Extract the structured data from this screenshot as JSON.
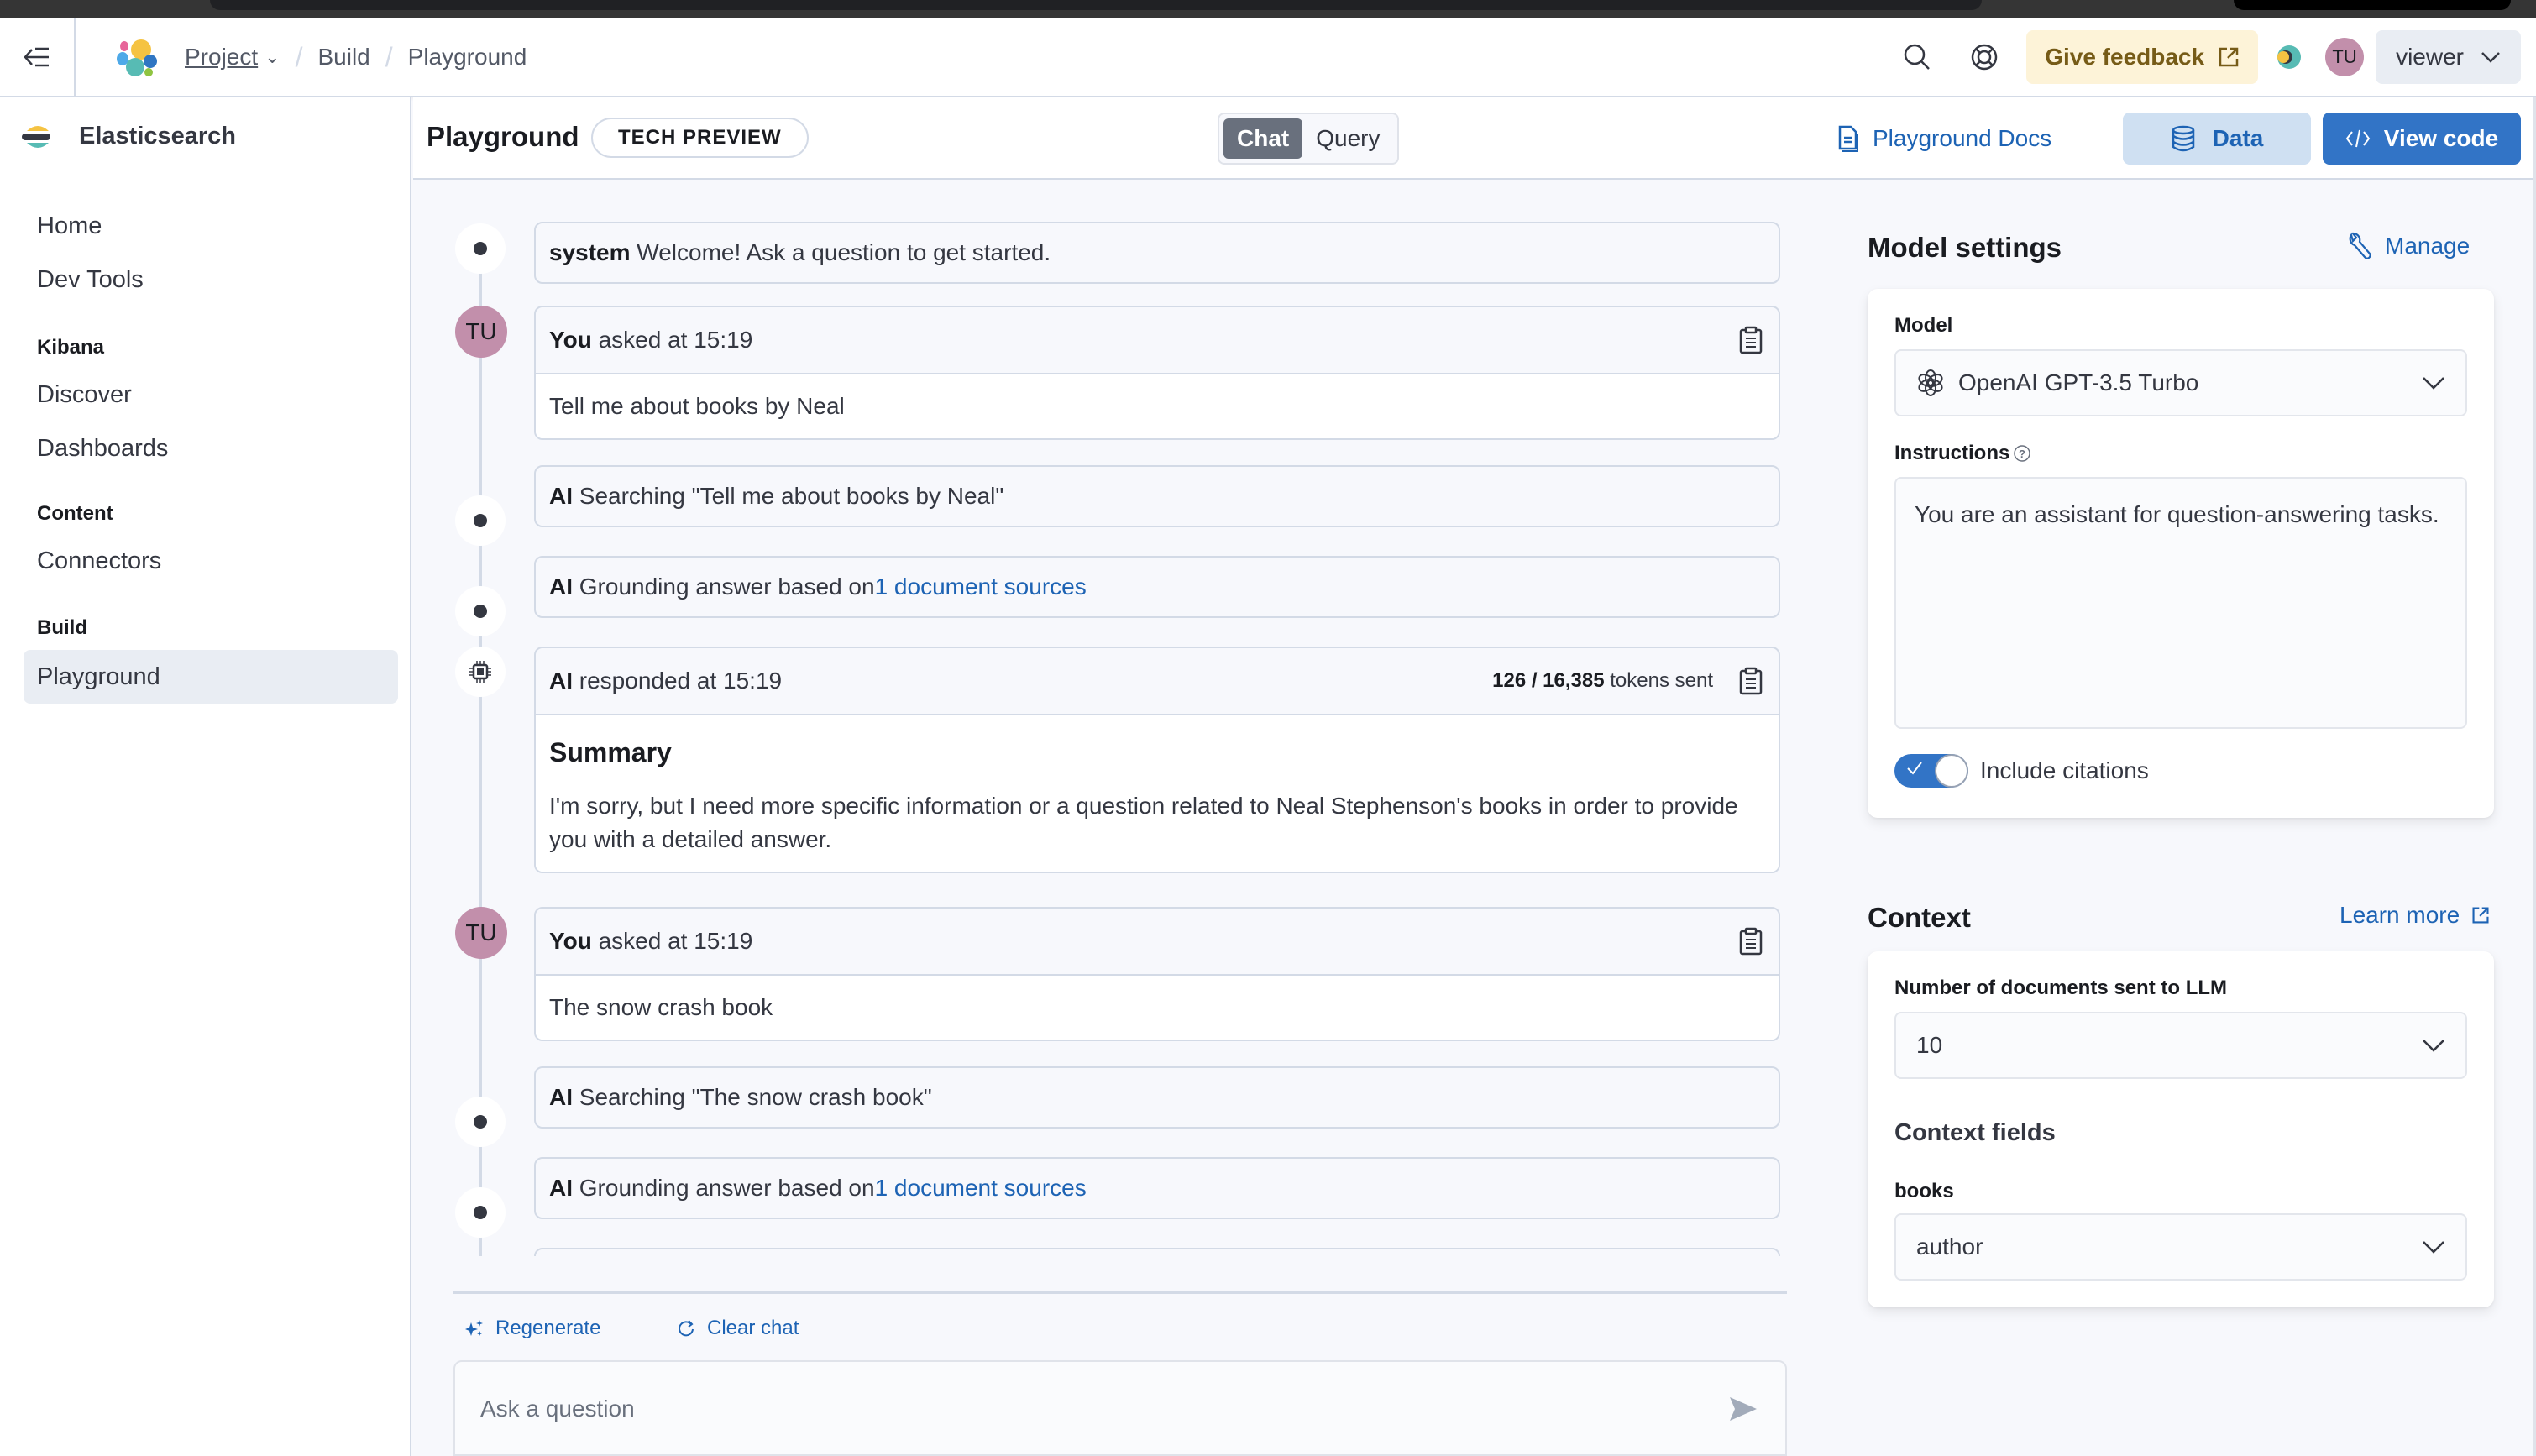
{
  "topnav": {
    "breadcrumbs": [
      "Project",
      "Build",
      "Playground"
    ],
    "feedback_label": "Give feedback",
    "user_initials": "TU",
    "role_label": "viewer"
  },
  "sidebar": {
    "brand": "Elasticsearch",
    "top_items": [
      {
        "label": "Home"
      },
      {
        "label": "Dev Tools"
      }
    ],
    "groups": [
      {
        "title": "Kibana",
        "items": [
          {
            "label": "Discover"
          },
          {
            "label": "Dashboards"
          }
        ]
      },
      {
        "title": "Content",
        "items": [
          {
            "label": "Connectors"
          }
        ]
      },
      {
        "title": "Build",
        "items": [
          {
            "label": "Playground",
            "active": true
          }
        ]
      }
    ]
  },
  "header": {
    "title": "Playground",
    "badge": "TECH PREVIEW",
    "modes": [
      {
        "label": "Chat",
        "selected": true
      },
      {
        "label": "Query",
        "selected": false
      }
    ],
    "docs_link": "Playground Docs",
    "data_button": "Data",
    "view_code_button": "View code"
  },
  "chat": {
    "messages": [
      {
        "role": "system",
        "prefix": "system",
        "text": "Welcome! Ask a question to get started."
      },
      {
        "role": "user",
        "prefix": "You",
        "meta": "asked at 15:19",
        "text": "Tell me about books by Neal"
      },
      {
        "role": "ai-status",
        "prefix": "AI",
        "text": "Searching \"Tell me about books by Neal\""
      },
      {
        "role": "ai-status",
        "prefix": "AI",
        "text": "Grounding answer based on",
        "link": "1 document sources"
      },
      {
        "role": "ai",
        "prefix": "AI",
        "meta": "responded at 15:19",
        "tokens_used": "126 / 16,385",
        "tokens_suffix": "tokens sent",
        "heading": "Summary",
        "text": "I'm sorry, but I need more specific information or a question related to Neal Stephenson's books in order to provide you with a detailed answer."
      },
      {
        "role": "user",
        "prefix": "You",
        "meta": "asked at 15:19",
        "text": "The snow crash book"
      },
      {
        "role": "ai-status",
        "prefix": "AI",
        "text": "Searching \"The snow crash book\""
      },
      {
        "role": "ai-status",
        "prefix": "AI",
        "text": "Grounding answer based on",
        "link": "1 document sources"
      }
    ],
    "regenerate_label": "Regenerate",
    "clear_label": "Clear chat",
    "input_placeholder": "Ask a question",
    "input_value": ""
  },
  "model_settings": {
    "title": "Model settings",
    "manage_label": "Manage",
    "model_label": "Model",
    "model_value": "OpenAI GPT-3.5 Turbo",
    "instructions_label": "Instructions",
    "instructions_value": "You are an assistant for question-answering tasks.",
    "citations_label": "Include citations",
    "citations_on": true
  },
  "context": {
    "title": "Context",
    "learn_more": "Learn more",
    "docs_label": "Number of documents sent to LLM",
    "docs_value": "10",
    "fields_title": "Context fields",
    "index_label": "books",
    "field_value": "author"
  },
  "colors": {
    "accent": "#3274c6",
    "link": "#1d63b4",
    "avatar": "#c28fab",
    "feedback_bg": "#fdf3d8"
  }
}
